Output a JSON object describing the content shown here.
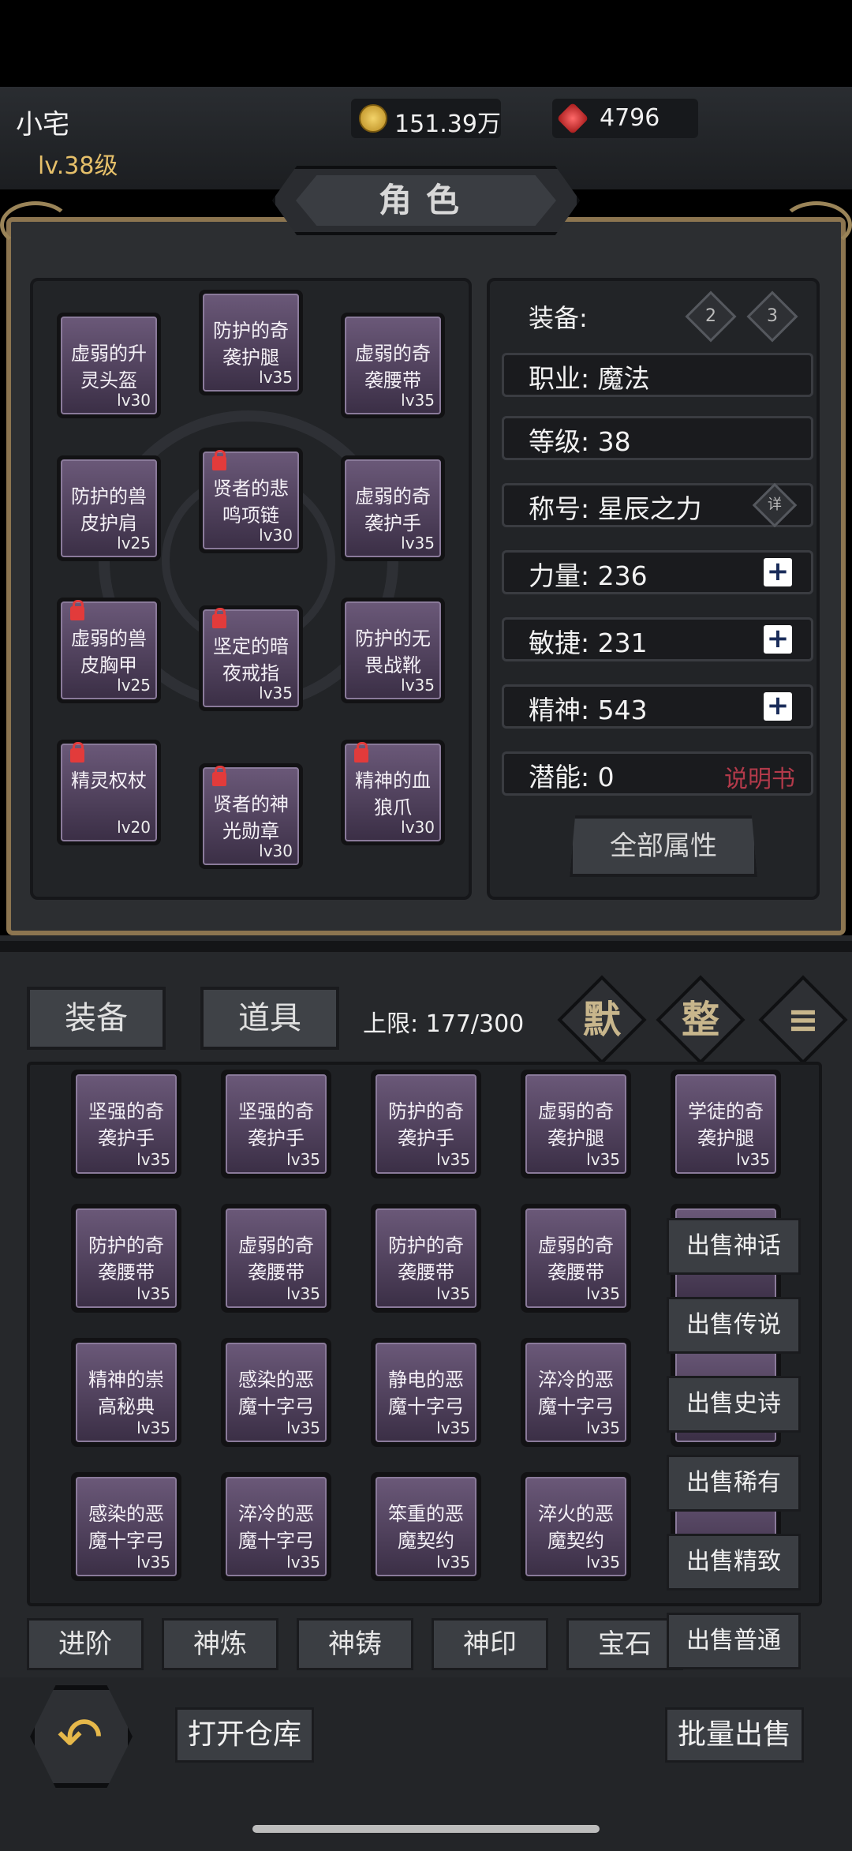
{
  "player": {
    "name": "小宅",
    "level": "lv.38级"
  },
  "resources": {
    "gold": "151.39万",
    "gems": "4796",
    "gold_icon": "gold-coin-icon",
    "gem_icon": "red-gem-icon"
  },
  "title": "角色",
  "equipped": [
    {
      "name": "虚弱的升灵头盔",
      "level": "lv30",
      "locked": false
    },
    {
      "name": "防护的奇袭护腿",
      "level": "lv35",
      "locked": false
    },
    {
      "name": "虚弱的奇袭腰带",
      "level": "lv35",
      "locked": false
    },
    {
      "name": "防护的兽皮护肩",
      "level": "lv25",
      "locked": false
    },
    {
      "name": "贤者的悲鸣项链",
      "level": "lv30",
      "locked": true
    },
    {
      "name": "虚弱的奇袭护手",
      "level": "lv35",
      "locked": false
    },
    {
      "name": "虚弱的兽皮胸甲",
      "level": "lv25",
      "locked": true
    },
    {
      "name": "坚定的暗夜戒指",
      "level": "lv35",
      "locked": true
    },
    {
      "name": "防护的无畏战靴",
      "level": "lv35",
      "locked": false
    },
    {
      "name": "精灵权杖",
      "level": "lv20",
      "locked": true
    },
    {
      "name": "贤者的神光勋章",
      "level": "lv30",
      "locked": true
    },
    {
      "name": "精神的血狼爪",
      "level": "lv30",
      "locked": true
    }
  ],
  "stats": {
    "equip_label": "装备:",
    "set_buttons": [
      "2",
      "3"
    ],
    "rows": [
      {
        "label": "职业:",
        "value": "魔法"
      },
      {
        "label": "等级:",
        "value": "38"
      },
      {
        "label": "称号:",
        "value": "星辰之力"
      },
      {
        "label": "力量:",
        "value": "236"
      },
      {
        "label": "敏捷:",
        "value": "231"
      },
      {
        "label": "精神:",
        "value": "543"
      },
      {
        "label": "潜能:",
        "value": "0"
      }
    ],
    "title_detail": "详",
    "manual_link": "说明书",
    "all_attr_button": "全部属性"
  },
  "inventory": {
    "tabs": [
      "装备",
      "道具"
    ],
    "capacity": "上限: 177/300",
    "corner_buttons": [
      "默",
      "整",
      "≡"
    ],
    "items": [
      {
        "name": "坚强的奇袭护手",
        "level": "lv35"
      },
      {
        "name": "坚强的奇袭护手",
        "level": "lv35"
      },
      {
        "name": "防护的奇袭护手",
        "level": "lv35"
      },
      {
        "name": "虚弱的奇袭护腿",
        "level": "lv35"
      },
      {
        "name": "学徒的奇袭护腿",
        "level": "lv35"
      },
      {
        "name": "防护的奇袭腰带",
        "level": "lv35"
      },
      {
        "name": "虚弱的奇袭腰带",
        "level": "lv35"
      },
      {
        "name": "防护的奇袭腰带",
        "level": "lv35"
      },
      {
        "name": "虚弱的奇袭腰带",
        "level": "lv35"
      },
      {
        "name": "精神的崇高秘典",
        "level": "lv35"
      },
      {
        "name": "感染的恶魔十字弓",
        "level": "lv35"
      },
      {
        "name": "静电的恶魔十字弓",
        "level": "lv35"
      },
      {
        "name": "淬冷的恶魔十字弓",
        "level": "lv35"
      },
      {
        "name": "感染的恶魔十字弓",
        "level": "lv35"
      },
      {
        "name": "淬冷的恶魔十字弓",
        "level": "lv35"
      },
      {
        "name": "笨重的恶魔契约",
        "level": "lv35"
      },
      {
        "name": "淬火的恶魔契约",
        "level": "lv35"
      }
    ],
    "sell_buttons": [
      "出售神话",
      "出售传说",
      "出售史诗",
      "出售稀有",
      "出售精致",
      "出售普通"
    ]
  },
  "bottom_tabs": [
    "进阶",
    "神炼",
    "神铸",
    "神印",
    "宝石"
  ],
  "footer": {
    "back_icon": "back-arrow-icon",
    "warehouse": "打开仓库",
    "bulk_sell": "批量出售"
  }
}
